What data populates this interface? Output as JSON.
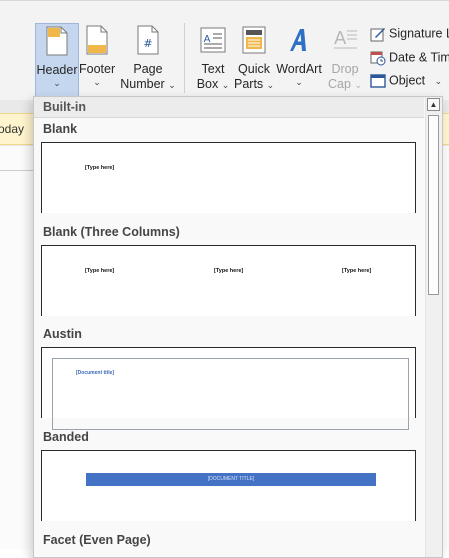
{
  "ribbon": {
    "header_label": "Header",
    "footer_label": "Footer",
    "page_number_label_1": "Page",
    "page_number_label_2": "Number",
    "text_box_label_1": "Text",
    "text_box_label_2": "Box",
    "quick_parts_label_1": "Quick",
    "quick_parts_label_2": "Parts",
    "wordart_label": "WordArt",
    "drop_cap_label_1": "Drop",
    "drop_cap_label_2": "Cap",
    "signature_label": "Signature L",
    "date_time_label": "Date & Tim",
    "object_label": "Object",
    "chevron": "⌄",
    "accent_color": "#2b579a"
  },
  "background": {
    "yellow_fragment": "oday"
  },
  "gallery": {
    "group_title": "Built-in",
    "items": [
      {
        "title": "Blank",
        "placeholder": "[Type here]"
      },
      {
        "title": "Blank (Three Columns)",
        "placeholders": [
          "[Type here]",
          "[Type here]",
          "[Type here]"
        ]
      },
      {
        "title": "Austin",
        "placeholder": "[Document title]"
      },
      {
        "title": "Banded",
        "placeholder": "[DOCUMENT TITLE]",
        "band_color": "#4472c4"
      },
      {
        "title": "Facet (Even Page)"
      }
    ]
  },
  "scrollbar": {
    "up_arrow": "▲"
  }
}
